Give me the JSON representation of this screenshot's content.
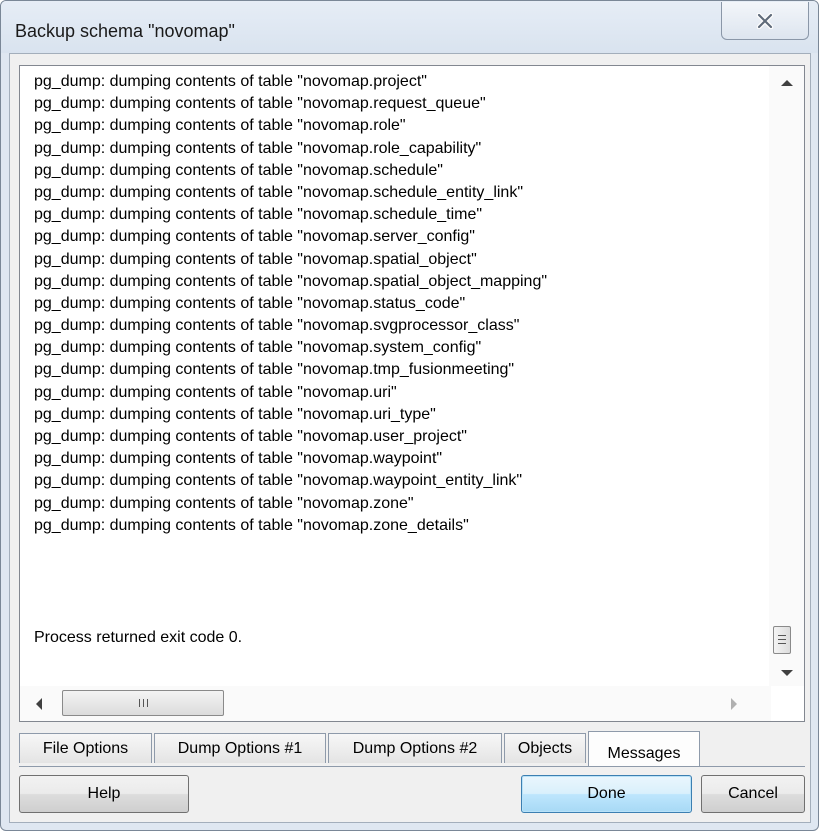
{
  "window": {
    "title": "Backup schema \"novomap\"",
    "close_icon": "close-icon"
  },
  "log": {
    "lines": [
      "pg_dump: dumping contents of table \"novomap.project\"",
      "pg_dump: dumping contents of table \"novomap.request_queue\"",
      "pg_dump: dumping contents of table \"novomap.role\"",
      "pg_dump: dumping contents of table \"novomap.role_capability\"",
      "pg_dump: dumping contents of table \"novomap.schedule\"",
      "pg_dump: dumping contents of table \"novomap.schedule_entity_link\"",
      "pg_dump: dumping contents of table \"novomap.schedule_time\"",
      "pg_dump: dumping contents of table \"novomap.server_config\"",
      "pg_dump: dumping contents of table \"novomap.spatial_object\"",
      "pg_dump: dumping contents of table \"novomap.spatial_object_mapping\"",
      "pg_dump: dumping contents of table \"novomap.status_code\"",
      "pg_dump: dumping contents of table \"novomap.svgprocessor_class\"",
      "pg_dump: dumping contents of table \"novomap.system_config\"",
      "pg_dump: dumping contents of table \"novomap.tmp_fusionmeeting\"",
      "pg_dump: dumping contents of table \"novomap.uri\"",
      "pg_dump: dumping contents of table \"novomap.uri_type\"",
      "pg_dump: dumping contents of table \"novomap.user_project\"",
      "pg_dump: dumping contents of table \"novomap.waypoint\"",
      "pg_dump: dumping contents of table \"novomap.waypoint_entity_link\"",
      "pg_dump: dumping contents of table \"novomap.zone\"",
      "pg_dump: dumping contents of table \"novomap.zone_details\""
    ],
    "exit_message": "Process returned exit code 0."
  },
  "tabs": [
    {
      "label": "File Options",
      "active": false
    },
    {
      "label": "Dump Options #1",
      "active": false
    },
    {
      "label": "Dump Options #2",
      "active": false
    },
    {
      "label": "Objects",
      "active": false
    },
    {
      "label": "Messages",
      "active": true
    }
  ],
  "buttons": {
    "help": "Help",
    "done": "Done",
    "cancel": "Cancel"
  },
  "scrollbar": {
    "h_grip": "III"
  }
}
